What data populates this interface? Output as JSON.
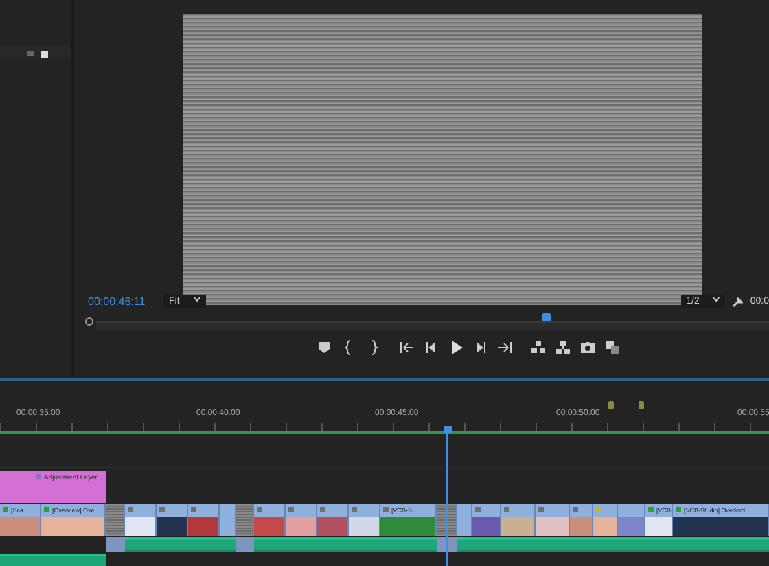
{
  "program_monitor": {
    "timecode": "00:00:46:11",
    "zoom": "Fit",
    "resolution": "1/2",
    "duration": "00:0",
    "playhead": {
      "level": 0.67
    }
  },
  "timeline": {
    "ruler": [
      "00:00:35:00",
      "00:00:40:00",
      "00:00:45:00",
      "00:00:50:00",
      "00:00:55"
    ],
    "v2": {
      "label": "Adjustment Layer"
    },
    "v1": [
      {
        "kind": "video",
        "label": "[Sca",
        "color": "#2e9e3a"
      },
      {
        "kind": "video",
        "label": "[Overview] Ove",
        "color": "#2e9e3a"
      },
      {
        "kind": "gap"
      },
      {
        "kind": "video",
        "color": "#6e6e6e"
      },
      {
        "kind": "video",
        "color": "#6e6e6e"
      },
      {
        "kind": "video",
        "color": "#6e6e6e"
      },
      {
        "kind": "blank"
      },
      {
        "kind": "gap"
      },
      {
        "kind": "video",
        "color": "#6e6e6e"
      },
      {
        "kind": "video",
        "color": "#6e6e6e"
      },
      {
        "kind": "video",
        "color": "#6e6e6e"
      },
      {
        "kind": "video",
        "color": "#6e6e6e"
      },
      {
        "kind": "video",
        "label": "[VCB-S",
        "color": "#6e6e6e"
      },
      {
        "kind": "gap"
      },
      {
        "kind": "blank"
      },
      {
        "kind": "video",
        "color": "#6e6e6e"
      },
      {
        "kind": "video",
        "color": "#6e6e6e"
      },
      {
        "kind": "video",
        "color": "#6e6e6e"
      },
      {
        "kind": "video",
        "color": "#6e6e6e"
      },
      {
        "kind": "video",
        "color": "#c9b32a"
      },
      {
        "kind": "video"
      },
      {
        "kind": "video",
        "label": "[VCB",
        "color": "#2e9e3a"
      },
      {
        "kind": "video",
        "label": "[VCB-Studio] Overlord",
        "color": "#2e9e3a"
      }
    ],
    "a1": [
      {
        "kind": "empty"
      },
      {
        "kind": "gap"
      },
      {
        "kind": "audio"
      },
      {
        "kind": "gap"
      },
      {
        "kind": "audio"
      },
      {
        "kind": "gap"
      },
      {
        "kind": "audio"
      }
    ],
    "a2": [
      {
        "kind": "audio"
      },
      {
        "kind": "empty"
      }
    ]
  }
}
